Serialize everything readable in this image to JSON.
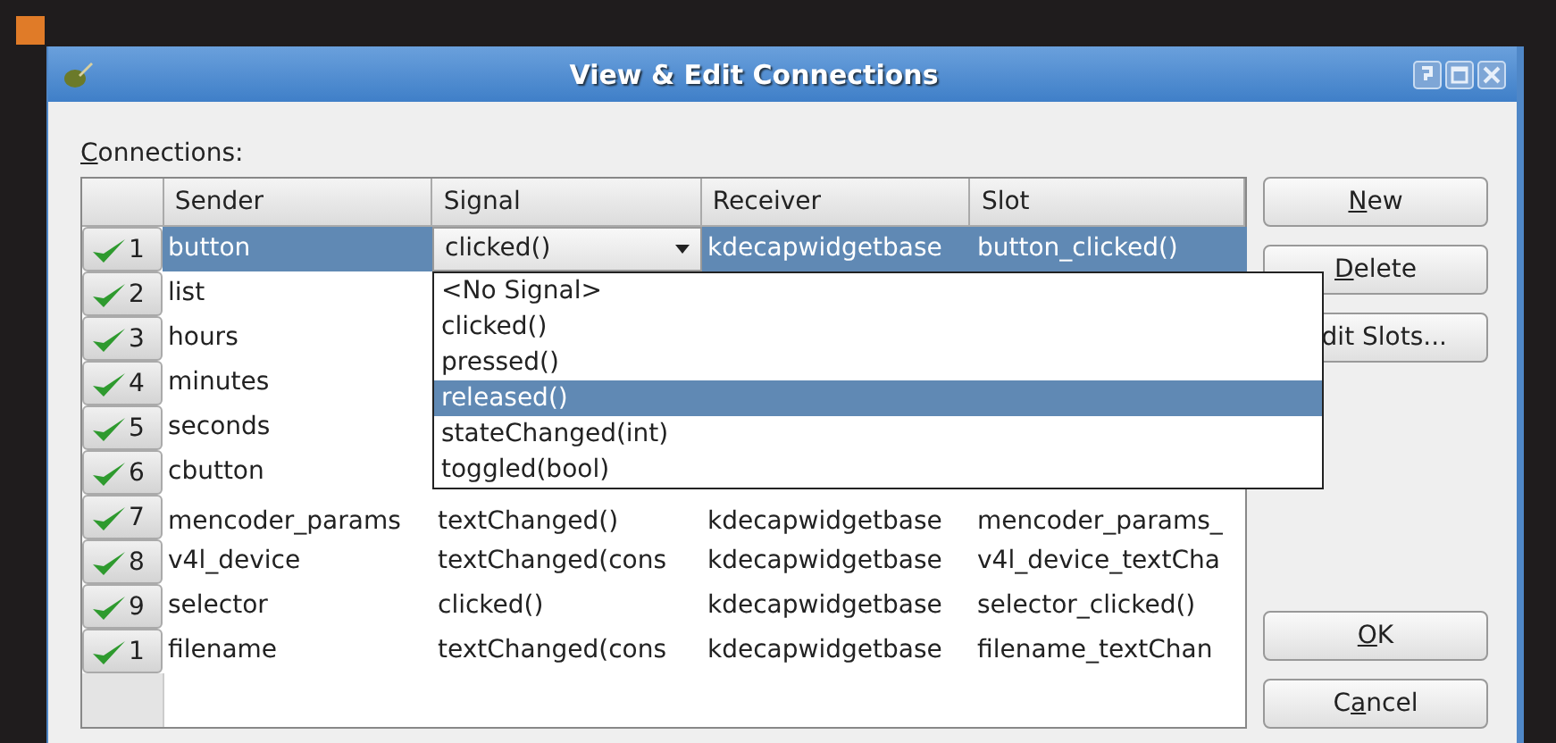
{
  "window": {
    "title": "View & Edit Connections"
  },
  "connections_label": {
    "access_key": "C",
    "suffix": "onnections:"
  },
  "table": {
    "columns": [
      "Sender",
      "Signal",
      "Receiver",
      "Slot"
    ],
    "rows": [
      {
        "number": "1",
        "checked": true,
        "selected": true,
        "sender": "button",
        "signal": "clicked()",
        "receiver": "kdecapwidgetbase",
        "slot": "button_clicked()"
      },
      {
        "number": "2",
        "checked": true,
        "selected": false,
        "sender": "list"
      },
      {
        "number": "3",
        "checked": true,
        "selected": false,
        "sender": "hours"
      },
      {
        "number": "4",
        "checked": true,
        "selected": false,
        "sender": "minutes"
      },
      {
        "number": "5",
        "checked": true,
        "selected": false,
        "sender": "seconds"
      },
      {
        "number": "6",
        "checked": true,
        "selected": false,
        "sender": "cbutton"
      },
      {
        "number": "7",
        "checked": true,
        "selected": false,
        "sender": "mencoder_params",
        "signal": "textChanged()",
        "receiver": "kdecapwidgetbase",
        "slot": "mencoder_params_"
      },
      {
        "number": "8",
        "checked": true,
        "selected": false,
        "sender": "v4l_device",
        "signal": "textChanged(cons",
        "receiver": "kdecapwidgetbase",
        "slot": "v4l_device_textCha"
      },
      {
        "number": "9",
        "checked": true,
        "selected": false,
        "sender": "selector",
        "signal": "clicked()",
        "receiver": "kdecapwidgetbase",
        "slot": "selector_clicked()"
      },
      {
        "number": "1",
        "checked": true,
        "selected": false,
        "sender": "filename",
        "signal": "textChanged(cons",
        "receiver": "kdecapwidgetbase",
        "slot": "filename_textChan"
      }
    ]
  },
  "signal_popup": {
    "options": [
      {
        "label": "<No Signal>",
        "selected": false
      },
      {
        "label": "clicked()",
        "selected": false
      },
      {
        "label": "pressed()",
        "selected": false
      },
      {
        "label": "released()",
        "selected": true
      },
      {
        "label": "stateChanged(int)",
        "selected": false
      },
      {
        "label": "toggled(bool)",
        "selected": false
      }
    ]
  },
  "buttons_top": [
    {
      "access_key": "N",
      "suffix": "ew"
    },
    {
      "access_key": "D",
      "suffix": "elete"
    },
    {
      "prefix": "dit Slots..."
    }
  ],
  "buttons_bottom": [
    {
      "access_key": "O",
      "suffix": "K"
    },
    {
      "prefix": "C",
      "access_key": "a",
      "suffix": "ncel"
    }
  ]
}
